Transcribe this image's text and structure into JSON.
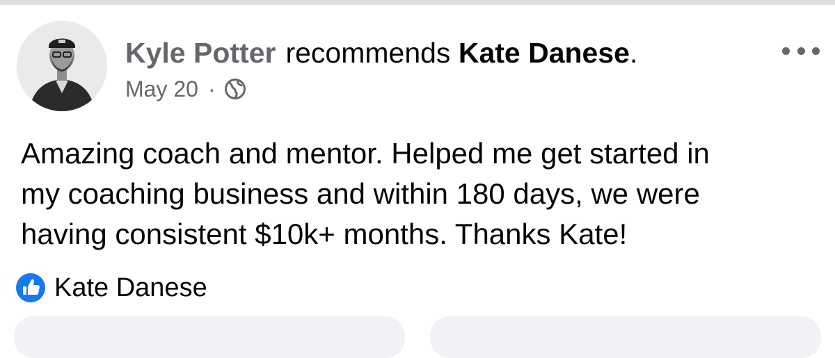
{
  "post": {
    "author": "Kyle Potter",
    "action_text": "recommends",
    "target": "Kate Danese",
    "target_suffix": ".",
    "date": "May 20",
    "separator": "·",
    "privacy_icon": "globe-icon",
    "body_lines": [
      "Amazing coach and mentor. Helped me get started in",
      "my coaching business and within 180 days, we were",
      "having consistent $10k+ months. Thanks Kate!"
    ]
  },
  "menu": {
    "icon": "more-options-icon"
  },
  "recommendation": {
    "icon": "recommend-thumbs-up-icon",
    "label": "Kate Danese",
    "accent": "#1877f2"
  },
  "colors": {
    "secondary_text": "#65676b",
    "primary_text": "#050505",
    "button_bg": "#f0f2f5"
  }
}
